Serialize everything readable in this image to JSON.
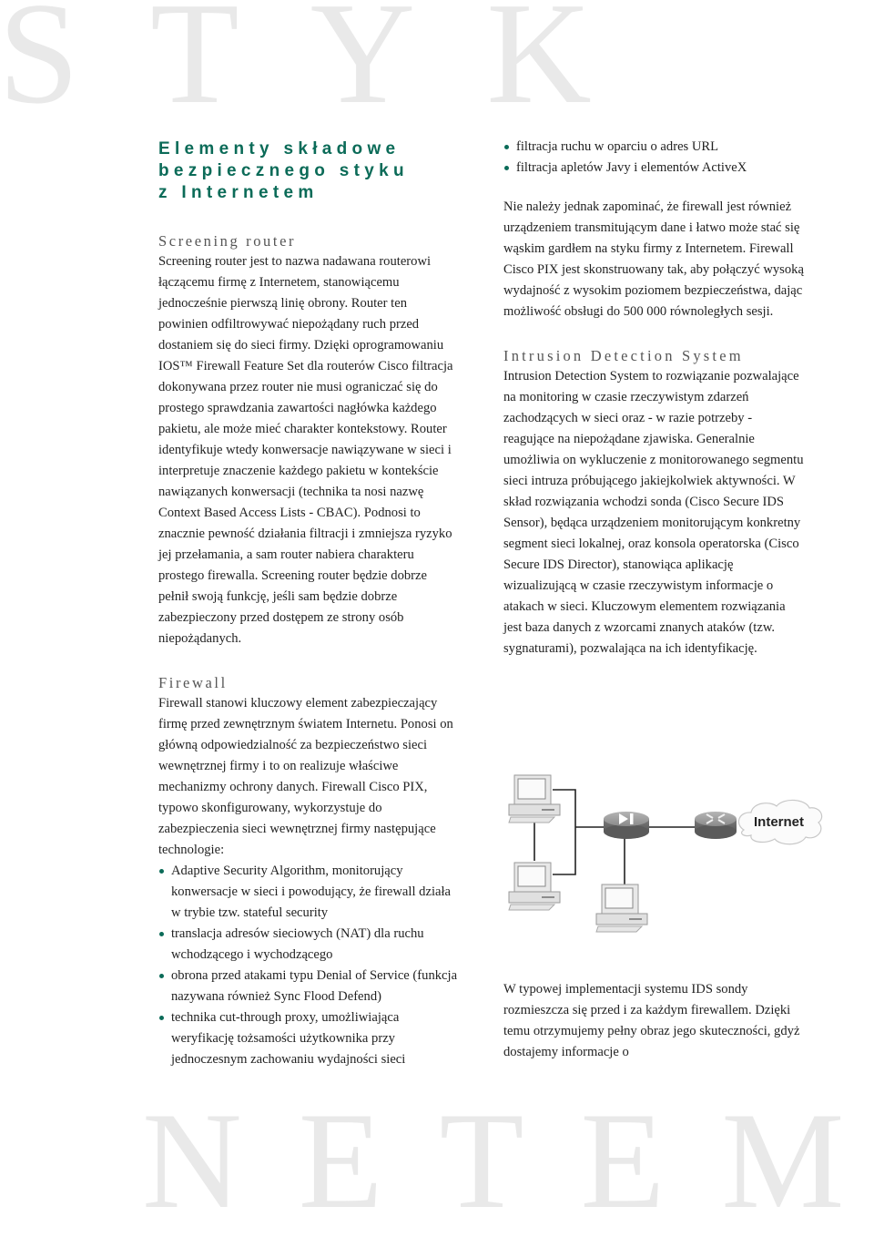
{
  "watermark": {
    "top": "STYK",
    "bottom": "NETEM"
  },
  "title": {
    "lines": [
      "Elementy składowe",
      "bezpiecznego styku",
      "z Internetem"
    ]
  },
  "colors": {
    "accent": "#0b6b58",
    "heading": "#555555",
    "watermark": "#e9e9e9"
  },
  "screening_router": {
    "heading": "Screening router",
    "body": "Screening router jest to nazwa nadawana routerowi łączącemu firmę z Internetem, stanowiącemu jednocześnie pierwszą linię obrony. Router ten powinien odfiltrowywać niepożądany ruch przed dostaniem się do sieci firmy. Dzięki oprogramowaniu IOS™ Firewall Feature Set dla routerów Cisco filtracja dokonywana przez router nie musi ograniczać się do prostego sprawdzania zawartości nagłówka każdego pakietu, ale może mieć charakter kontekstowy. Router identyfikuje wtedy konwersacje nawiązywane w sieci i interpretuje znaczenie każdego pakietu w kontekście nawiązanych konwersacji (technika ta nosi nazwę Context Based Access Lists - CBAC). Podnosi to znacznie pewność działania filtracji i zmniejsza ryzyko jej przełamania, a sam router nabiera charakteru prostego firewalla. Screening router będzie dobrze pełnił swoją funkcję, jeśli sam będzie dobrze zabezpieczony przed dostępem ze strony osób niepożądanych."
  },
  "firewall": {
    "heading": "Firewall",
    "body": "Firewall stanowi kluczowy element zabezpieczający firmę przed zewnętrznym światem Internetu. Ponosi on główną odpowiedzialność za bezpieczeństwo sieci wewnętrznej firmy i to on realizuje właściwe mechanizmy ochrony danych. Firewall Cisco PIX, typowo skonfigurowany, wykorzystuje do zabezpieczenia sieci wewnętrznej firmy następujące technologie:",
    "bullets": [
      "Adaptive Security Algorithm, monitorujący konwersacje w sieci i powodujący, że firewall działa w trybie tzw. stateful security",
      "translacja adresów sieciowych (NAT) dla ruchu wchodzącego i wychodzącego",
      "obrona przed atakami typu Denial of Service (funkcja nazywana również Sync Flood Defend)",
      "technika cut-through proxy, umożliwiająca weryfikację tożsamości użytkownika przy jednoczesnym zachowaniu wydajności sieci",
      "filtracja ruchu w oparciu o adres URL",
      "filtracja apletów Javy i elementów ActiveX"
    ],
    "closing": "Nie należy jednak zapominać, że firewall jest również urządzeniem transmitującym dane i łatwo może stać się wąskim gardłem na styku firmy z Internetem. Firewall Cisco PIX jest skonstruowany tak, aby połączyć wysoką wydajność z wysokim poziomem bezpieczeństwa, dając możliwość obsługi do 500 000 równoległych sesji."
  },
  "ids": {
    "heading": "Intrusion Detection System",
    "body": "Intrusion Detection System to rozwiązanie pozwalające na monitoring w czasie rzeczywistym zdarzeń zachodzących w sieci oraz - w razie potrzeby - reagujące na niepożądane zjawiska. Generalnie umożliwia on wykluczenie z monitorowanego segmentu sieci intruza próbującego jakiejkolwiek aktywności. W skład rozwiązania wchodzi sonda (Cisco Secure IDS Sensor), będąca urządzeniem monitorującym konkretny segment sieci lokalnej, oraz konsola operatorska (Cisco Secure IDS Director), stanowiąca aplikację wizualizującą w czasie rzeczywistym informacje o atakach w sieci. Kluczowym elementem rozwiązania jest baza danych z wzorcami znanych ataków (tzw. sygnaturami), pozwalająca na ich identyfikację.",
    "after_diagram": "W typowej implementacji systemu IDS sondy rozmieszcza się przed i za każdym firewallem. Dzięki temu otrzymujemy pełny obraz jego skuteczności, gdyż dostajemy informacje o"
  },
  "diagram": {
    "nodes": [
      "workstation",
      "workstation",
      "firewall",
      "workstation",
      "router",
      "cloud"
    ],
    "cloud_label": "Internet"
  }
}
